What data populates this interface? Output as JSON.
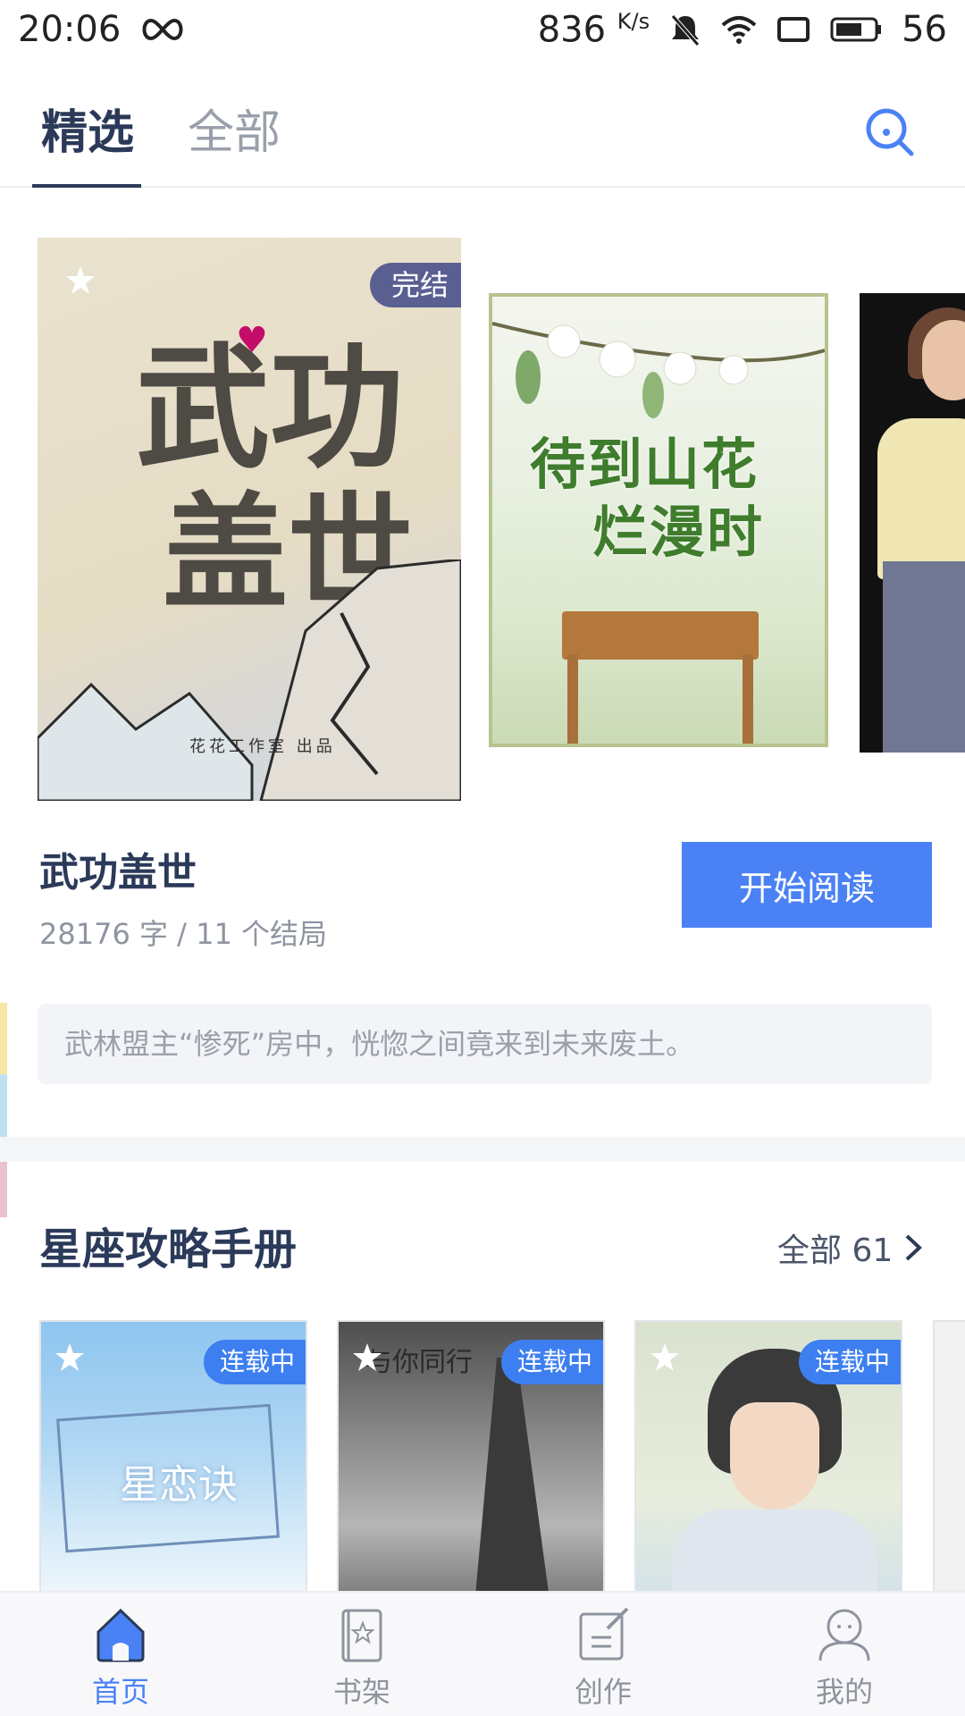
{
  "status_bar": {
    "time": "20:06",
    "speed": "836",
    "speed_unit": "K/s",
    "battery": "56"
  },
  "top_tabs": {
    "featured": "精选",
    "all": "全部"
  },
  "featured_book": {
    "cover_title_line1": "武功",
    "cover_title_line2": "盖世",
    "cover_studio": "花花工作室 出品",
    "badge": "完结",
    "title": "武功盖世",
    "meta": "28176 字 / 11 个结局",
    "read_button": "开始阅读",
    "description": "武林盟主“惨死”房中，恍惚之间竟来到未来废土。"
  },
  "carousel_second": {
    "cover_title_line1": "待到山花",
    "cover_title_line2": "烂漫时"
  },
  "section": {
    "title": "星座攻略手册",
    "see_all": "全部 61"
  },
  "section_books": [
    {
      "badge": "连载中",
      "cover_text": "星恋诀"
    },
    {
      "badge": "连载中",
      "cover_text": "与你同行"
    },
    {
      "badge": "连载中"
    }
  ],
  "bottom_nav": {
    "home": "首页",
    "shelf": "书架",
    "create": "创作",
    "mine": "我的"
  },
  "colors": {
    "accent": "#4a82f5",
    "title": "#2b3a59",
    "badge_done": "#5a5f91",
    "badge_ongoing": "#3d7ff0"
  }
}
